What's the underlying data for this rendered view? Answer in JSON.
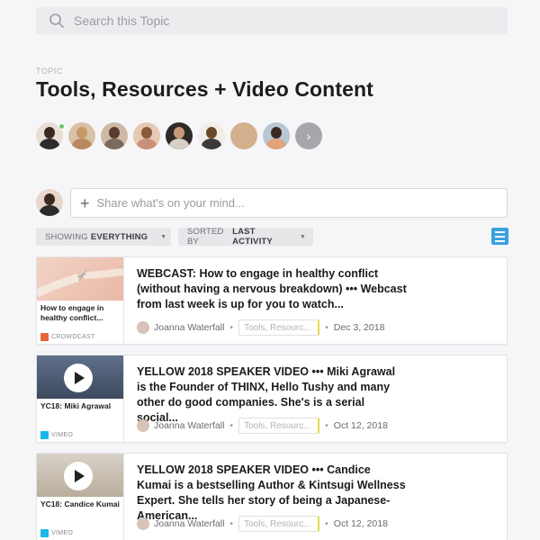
{
  "search": {
    "placeholder": "Search this Topic"
  },
  "topic": {
    "label": "TOPIC",
    "title": "Tools, Resources + Video Content"
  },
  "members": {
    "more_label": "›"
  },
  "composer": {
    "placeholder": "Share what's on your mind..."
  },
  "filters": {
    "showing_prefix": "SHOWING",
    "showing_value": "EVERYTHING",
    "sorted_prefix": "SORTED BY",
    "sorted_value": "LAST ACTIVITY"
  },
  "posts": [
    {
      "thumb_caption": "How to engage in healthy conflict...",
      "source": "CROWDCAST",
      "excerpt": "WEBCAST: How to engage in healthy conflict (without having a nervous breakdown) ••• Webcast from last week is up for you to watch...",
      "author": "Joanna Waterfall",
      "tag": "Tools, Resourc...",
      "date": "Dec 3, 2018"
    },
    {
      "thumb_caption": "YC18: Miki Agrawal",
      "source": "VIMEO",
      "excerpt": "YELLOW 2018 SPEAKER VIDEO ••• Miki Agrawal is the Founder of THINX, Hello Tushy and many other do good companies. She's is a serial social...",
      "author": "Joanna Waterfall",
      "tag": "Tools, Resourc...",
      "date": "Oct 12, 2018"
    },
    {
      "thumb_caption": "YC18: Candice Kumai",
      "source": "VIMEO",
      "excerpt": "YELLOW 2018 SPEAKER VIDEO ••• Candice Kumai is a bestselling Author & Kintsugi Wellness Expert. She tells her story of being a Japanese-American...",
      "author": "Joanna Waterfall",
      "tag": "Tools, Resourc...",
      "date": "Oct 12, 2018"
    }
  ],
  "colors": {
    "accent": "#3aa0de",
    "tag_marker": "#e3dc4b",
    "online": "#6cc36a"
  }
}
